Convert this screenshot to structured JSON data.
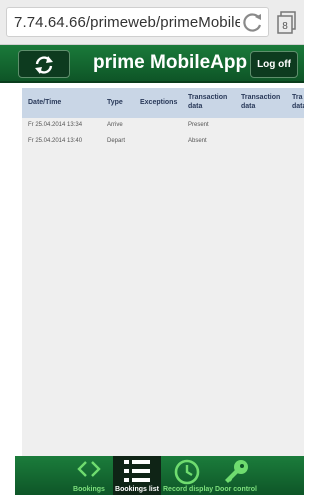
{
  "browser": {
    "url": "7.74.64.66/primeweb/primeMobile",
    "reload_icon": "reload-icon",
    "tabs_icon": "tabs-icon",
    "tab_count": "8"
  },
  "header": {
    "title": "prime MobileApp",
    "logoff_label": "Log off",
    "refresh_icon": "refresh-icon"
  },
  "table": {
    "columns": [
      "Date/Time",
      "Type",
      "Exceptions",
      "Transaction data",
      "Transaction data",
      "Tra data"
    ],
    "rows": [
      {
        "datetime": "Fr 25.04.2014 13:34",
        "type": "Arrive",
        "exceptions": "",
        "transaction": "Present"
      },
      {
        "datetime": "Fr 25.04.2014 13:40",
        "type": "Depart",
        "exceptions": "",
        "transaction": "Absent"
      }
    ]
  },
  "nav": {
    "items": [
      {
        "label": "Bookings",
        "icon": "code-brackets-icon",
        "active": false
      },
      {
        "label": "Bookings list",
        "icon": "list-icon",
        "active": true
      },
      {
        "label": "Record display",
        "icon": "clock-icon",
        "active": false
      },
      {
        "label": "Door control",
        "icon": "key-icon",
        "active": false
      }
    ]
  },
  "colors": {
    "header_green": "#1a7a3a",
    "nav_label_green": "#7de07d",
    "table_header": "#c9d6e6"
  }
}
